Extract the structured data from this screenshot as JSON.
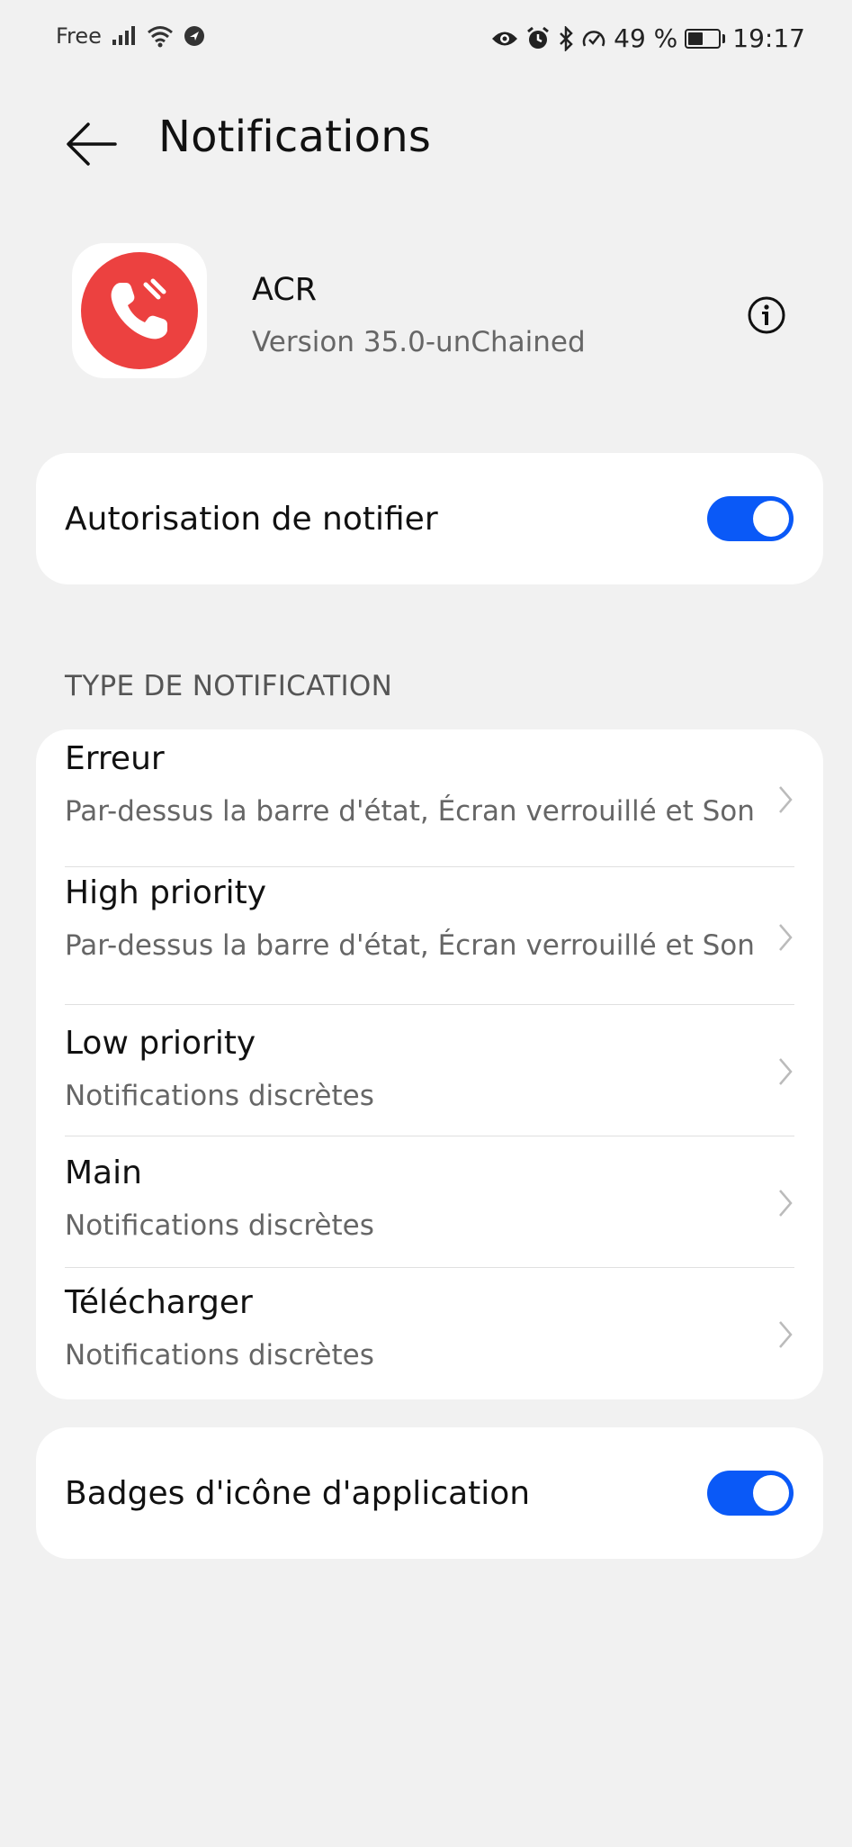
{
  "status_bar": {
    "carrier": "Free",
    "battery_text": "49 %",
    "battery_level": 0.49,
    "time": "19:17",
    "left_icons": [
      "signal-icon",
      "wifi-icon",
      "location-icon"
    ],
    "right_icons": [
      "eye-icon",
      "alarm-icon",
      "bluetooth-icon",
      "data-saver-icon",
      "battery-icon"
    ]
  },
  "header": {
    "title": "Notifications",
    "back_icon": "back-arrow-icon"
  },
  "app": {
    "name": "ACR",
    "version": "Version 35.0-unChained",
    "icon": "phone-icon",
    "icon_color": "#ec4140",
    "info_icon": "info-icon"
  },
  "main_toggle": {
    "label": "Autorisation de notifier",
    "enabled": true
  },
  "section": {
    "title": "TYPE DE NOTIFICATION"
  },
  "channels": [
    {
      "title": "Erreur",
      "subtitle": "Par-dessus la barre d'état, Écran verrouillé et Son"
    },
    {
      "title": "High priority",
      "subtitle": "Par-dessus la barre d'état, Écran verrouillé et Son"
    },
    {
      "title": "Low priority",
      "subtitle": "Notifications discrètes"
    },
    {
      "title": "Main",
      "subtitle": "Notifications discrètes"
    },
    {
      "title": "Télécharger",
      "subtitle": "Notifications discrètes"
    }
  ],
  "badges_toggle": {
    "label": "Badges d'icône d'application",
    "enabled": true
  },
  "colors": {
    "accent": "#0a59f7",
    "background": "#f1f1f1",
    "card": "#ffffff"
  }
}
